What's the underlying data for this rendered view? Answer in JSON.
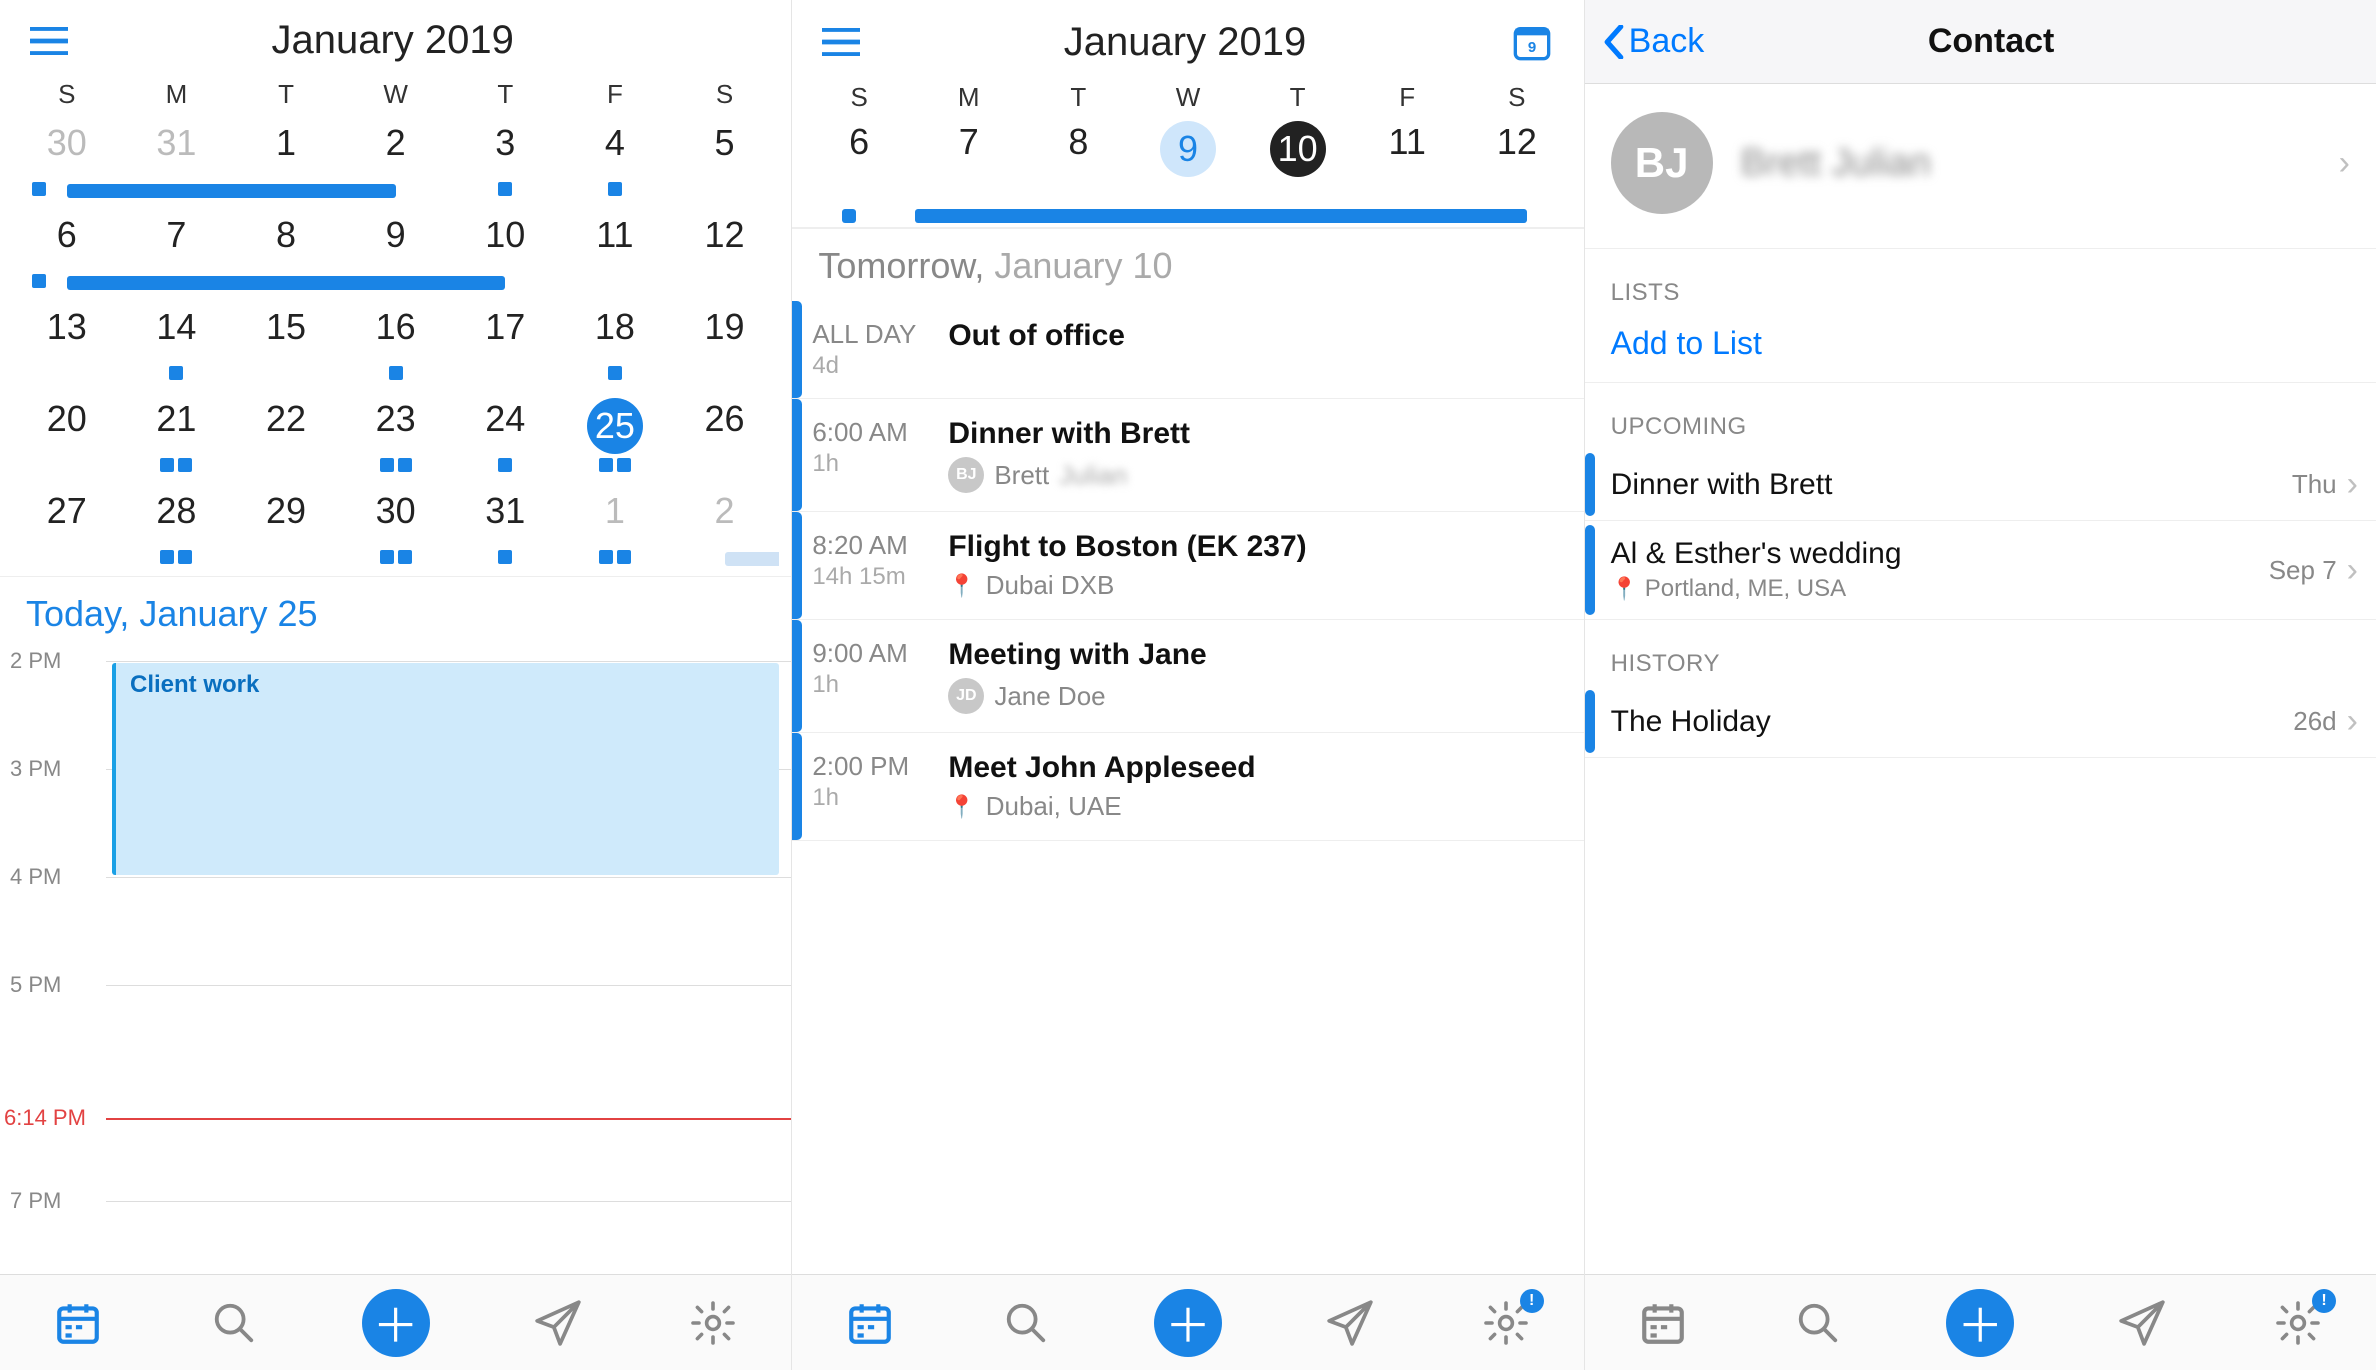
{
  "month_title": "January 2019",
  "weekdays": [
    "S",
    "M",
    "T",
    "W",
    "T",
    "F",
    "S"
  ],
  "panel1": {
    "today_label": "Today,",
    "today_date": "January 25",
    "hours": [
      "2 PM",
      "3 PM",
      "4 PM",
      "5 PM",
      "7 PM"
    ],
    "now_time": "6:14 PM",
    "event_title": "Client work",
    "days": [
      {
        "n": "30",
        "muted": true,
        "bar": {
          "type": "start",
          "dot": true
        }
      },
      {
        "n": "31",
        "muted": true,
        "bar": {
          "type": "mid"
        }
      },
      {
        "n": "1",
        "bar": {
          "type": "mid"
        }
      },
      {
        "n": "2",
        "bar": {
          "type": "end"
        }
      },
      {
        "n": "3",
        "dots": 1
      },
      {
        "n": "4",
        "dots": 1
      },
      {
        "n": "5"
      },
      {
        "n": "6",
        "bar": {
          "type": "start",
          "dot": true
        }
      },
      {
        "n": "7",
        "bar": {
          "type": "mid"
        }
      },
      {
        "n": "8",
        "bar": {
          "type": "mid"
        }
      },
      {
        "n": "9",
        "bar": {
          "type": "mid"
        }
      },
      {
        "n": "10",
        "bar": {
          "type": "end"
        }
      },
      {
        "n": "11"
      },
      {
        "n": "12"
      },
      {
        "n": "13"
      },
      {
        "n": "14",
        "dots": 1
      },
      {
        "n": "15"
      },
      {
        "n": "16",
        "dots": 1
      },
      {
        "n": "17"
      },
      {
        "n": "18",
        "dots": 1
      },
      {
        "n": "19"
      },
      {
        "n": "20"
      },
      {
        "n": "21",
        "dots": 2
      },
      {
        "n": "22"
      },
      {
        "n": "23",
        "dots": 2
      },
      {
        "n": "24",
        "dots": 1
      },
      {
        "n": "25",
        "sel": "sel-solid",
        "dots": 2
      },
      {
        "n": "26"
      },
      {
        "n": "27"
      },
      {
        "n": "28",
        "dots": 2
      },
      {
        "n": "29"
      },
      {
        "n": "30",
        "dots": 2
      },
      {
        "n": "31",
        "dots": 1
      },
      {
        "n": "1",
        "muted": true,
        "dots": 2
      },
      {
        "n": "2",
        "muted": true,
        "bar": {
          "type": "start",
          "light": true
        }
      }
    ]
  },
  "panel2": {
    "tomorrow_label": "Tomorrow,",
    "tomorrow_date": "January 10",
    "week": [
      {
        "n": "6"
      },
      {
        "n": "7"
      },
      {
        "n": "8"
      },
      {
        "n": "9",
        "sel": "sel-light"
      },
      {
        "n": "10",
        "sel": "sel-dark"
      },
      {
        "n": "11"
      },
      {
        "n": "12"
      }
    ],
    "week_bar": true,
    "events": [
      {
        "time": "ALL DAY",
        "dur": "4d",
        "title": "Out of office"
      },
      {
        "time": "6:00 AM",
        "dur": "1h",
        "title": "Dinner with Brett",
        "person": "Brett",
        "person_last": "Julian",
        "initials": "BJ"
      },
      {
        "time": "8:20 AM",
        "dur": "14h 15m",
        "title": "Flight to Boston (EK 237)",
        "loc": "Dubai DXB"
      },
      {
        "time": "9:00 AM",
        "dur": "1h",
        "title": "Meeting with Jane",
        "person": "Jane Doe",
        "initials": "JD"
      },
      {
        "time": "2:00 PM",
        "dur": "1h",
        "title": "Meet John Appleseed",
        "loc": "Dubai, UAE"
      }
    ]
  },
  "panel3": {
    "back": "Back",
    "nav_title": "Contact",
    "initials": "BJ",
    "name": "Brett Julian",
    "lists_label": "LISTS",
    "add_to_list": "Add to List",
    "upcoming_label": "UPCOMING",
    "upcoming": [
      {
        "title": "Dinner with Brett",
        "right": "Thu"
      },
      {
        "title": "Al & Esther's wedding",
        "sub": "Portland, ME, USA",
        "right": "Sep 7"
      }
    ],
    "history_label": "HISTORY",
    "history": [
      {
        "title": "The Holiday",
        "right": "26d"
      }
    ]
  },
  "colors": {
    "accent": "#1a84e5",
    "ios_blue": "#007aff"
  }
}
